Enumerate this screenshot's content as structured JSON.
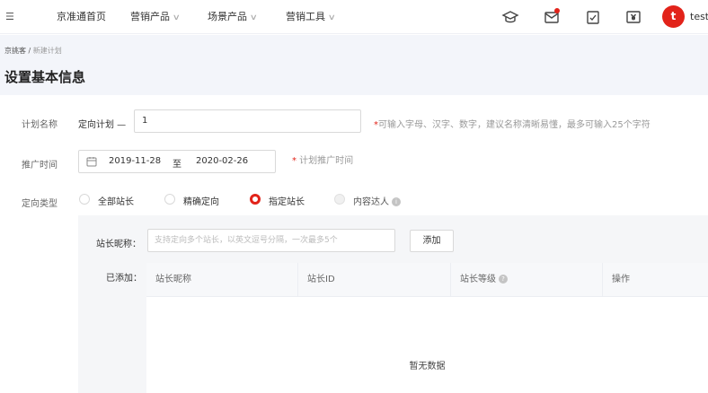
{
  "nav": {
    "menu_icon": "menu-toggle-icon",
    "items": [
      {
        "label": "京准通首页"
      },
      {
        "label": "营销产品"
      },
      {
        "label": "场景产品"
      },
      {
        "label": "营销工具"
      }
    ],
    "user": {
      "avatar_letter": "t",
      "name": "test_"
    }
  },
  "header": {
    "breadcrumb": {
      "parent": "京挑客",
      "separator": " / ",
      "current": "新建计划"
    },
    "title": "设置基本信息"
  },
  "form": {
    "name": {
      "label": "计划名称",
      "prefix": "定向计划 —",
      "value": "1",
      "hint_star": "*",
      "hint": "可输入字母、汉字、数字，建议名称清晰易懂，最多可输入25个字符"
    },
    "time": {
      "label": "推广时间",
      "start": "2019-11-28",
      "separator": "至",
      "end": "2020-02-26",
      "hint_star": "*",
      "hint": " 计划推广时间"
    },
    "type": {
      "label": "定向类型",
      "options": [
        {
          "label": "全部站长",
          "state": "unchecked"
        },
        {
          "label": "精确定向",
          "state": "unchecked"
        },
        {
          "label": "指定站长",
          "state": "checked"
        },
        {
          "label": "内容达人",
          "state": "disabled"
        }
      ]
    }
  },
  "panel": {
    "nickname_label": "站长昵称：",
    "input_placeholder": "支持定向多个站长，以英文逗号分隔，一次最多5个",
    "add_button": "添加",
    "added_label": "已添加：",
    "table": {
      "columns": [
        "站长昵称",
        "站长ID",
        "站长等级",
        "操作"
      ],
      "rows": [],
      "empty_text": "暂无数据"
    }
  },
  "colors": {
    "brand_red": "#e2231a",
    "header_band": "#f3f5fa",
    "panel_gray": "#f5f6f8"
  }
}
